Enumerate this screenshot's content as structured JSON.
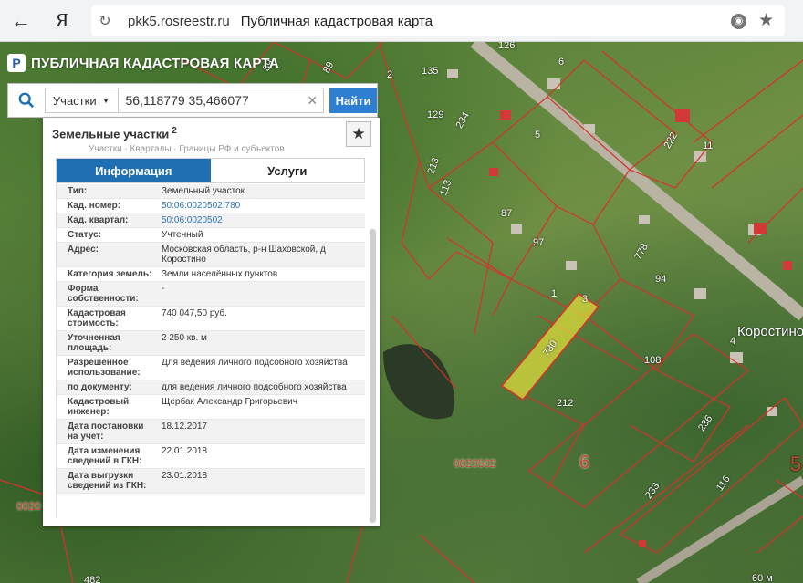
{
  "browser": {
    "back_glyph": "←",
    "logo_letter": "Я",
    "url": "pkk5.rosreestr.ru",
    "page_title": "Публичная кадастровая карта"
  },
  "app": {
    "logo_letter": "Р",
    "title": "ПУБЛИЧНАЯ КАДАСТРОВАЯ КАРТА"
  },
  "search": {
    "type_label": "Участки",
    "query": "56,118779 35,466077",
    "clear_glyph": "✕",
    "find_label": "Найти"
  },
  "panel": {
    "title": "Земельные участки",
    "count": "2",
    "faded_tabs": "Участки · Кварталы · Границы РФ и субъектов",
    "tabs": [
      {
        "label": "Информация",
        "active": true
      },
      {
        "label": "Услуги",
        "active": false
      }
    ],
    "rows": [
      {
        "label": "Тип:",
        "value": "Земельный участок",
        "link": false
      },
      {
        "label": "Кад. номер:",
        "value": "50:06:0020502:780",
        "link": true
      },
      {
        "label": "Кад. квартал:",
        "value": "50:06:0020502",
        "link": true
      },
      {
        "label": "Статус:",
        "value": "Учтенный",
        "link": false
      },
      {
        "label": "Адрес:",
        "value": "Московская область, р-н Шаховской, д Коростино",
        "link": false
      },
      {
        "label": "Категория земель:",
        "value": "Земли населённых пунктов",
        "link": false
      },
      {
        "label": "Форма собственности:",
        "value": "-",
        "link": false
      },
      {
        "label": "Кадастровая стоимость:",
        "value": "740 047,50 руб.",
        "link": false
      },
      {
        "label": "Уточненная площадь:",
        "value": "2 250 кв. м",
        "link": false
      },
      {
        "label": "Разрешенное использование:",
        "value": "Для ведения личного подсобного хозяйства",
        "link": false
      },
      {
        "label": "по документу:",
        "value": "для ведения личного подсобного хозяйства",
        "link": false
      },
      {
        "label": "Кадастровый инженер:",
        "value": "Щербак Александр Григорьевич",
        "link": false
      },
      {
        "label": "Дата постановки на учет:",
        "value": "18.12.2017",
        "link": false
      },
      {
        "label": "Дата изменения сведений в ГКН:",
        "value": "22.01.2018",
        "link": false
      },
      {
        "label": "Дата выгрузки сведений из ГКН:",
        "value": "23.01.2018",
        "link": false
      }
    ]
  },
  "map": {
    "labels": {
      "village": "Коростино",
      "quarter": "0020502",
      "quarter_left": "0020",
      "selected_parcel": "780",
      "big_six": "6",
      "edge_five": "5",
      "scale": "60 м",
      "parcels": [
        "135",
        "129",
        "213",
        "113",
        "87",
        "97",
        "94",
        "108",
        "212",
        "233",
        "236",
        "116",
        "222",
        "11",
        "234",
        "3",
        "1",
        "2",
        "4",
        "89",
        "126",
        "6",
        "778",
        "5",
        "482",
        "89"
      ]
    }
  }
}
